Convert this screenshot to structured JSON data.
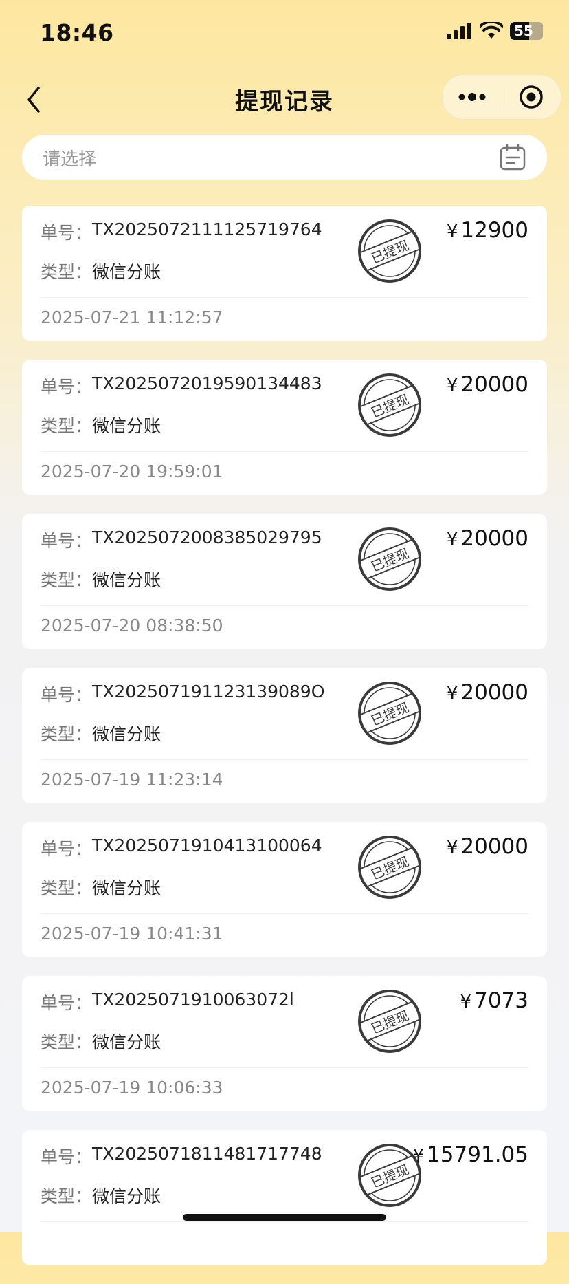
{
  "status_bar": {
    "time": "18:46",
    "battery": "55"
  },
  "nav": {
    "title": "提现记录"
  },
  "search": {
    "placeholder": "请选择"
  },
  "labels": {
    "order": "单号：",
    "type": "类型：",
    "stamp": "已提现",
    "currency": "¥"
  },
  "records": [
    {
      "order": "TX2025072111125719764",
      "type": "微信分账",
      "time": "2025-07-21 11:12:57",
      "amount": "12900"
    },
    {
      "order": "TX2025072019590134483",
      "type": "微信分账",
      "time": "2025-07-20 19:59:01",
      "amount": "20000"
    },
    {
      "order": "TX2025072008385029795",
      "type": "微信分账",
      "time": "2025-07-20 08:38:50",
      "amount": "20000"
    },
    {
      "order": "TX202507191123139089O",
      "type": "微信分账",
      "time": "2025-07-19 11:23:14",
      "amount": "20000"
    },
    {
      "order": "TX2025071910413100064",
      "type": "微信分账",
      "time": "2025-07-19 10:41:31",
      "amount": "20000"
    },
    {
      "order": "TX2025071910063072l",
      "type": "微信分账",
      "time": "2025-07-19 10:06:33",
      "amount": "7073"
    },
    {
      "order": "TX2025071811481717748",
      "type": "微信分账",
      "time": "",
      "amount": "15791.05"
    }
  ]
}
